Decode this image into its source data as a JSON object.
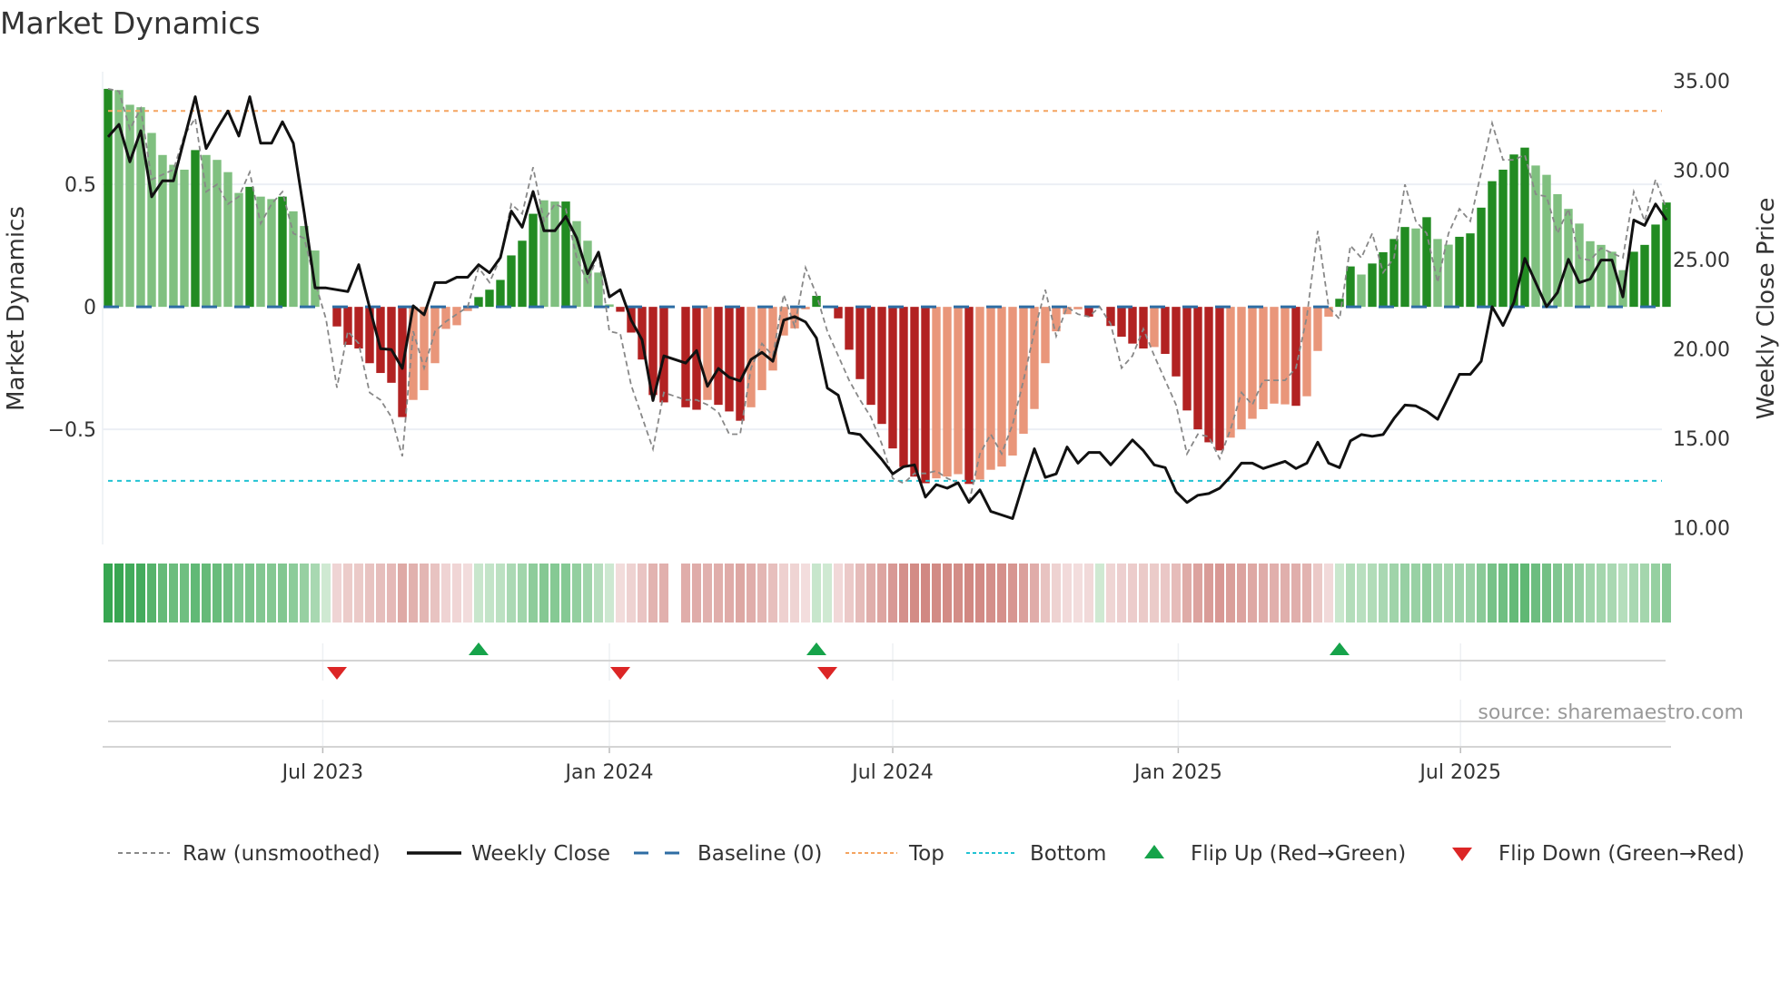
{
  "title": "Market Dynamics",
  "source": "source: sharemaestro.com",
  "chart_data": {
    "type": "bar",
    "title": "Market Dynamics",
    "ylabel": "Market Dynamics",
    "y2label": "Weekly Close Price",
    "ylim": [
      -0.97,
      0.96
    ],
    "y2lim": [
      9.05,
      35.5
    ],
    "yticks": [
      {
        "v": 0.5,
        "label": "0.5"
      },
      {
        "v": 0,
        "label": "0"
      },
      {
        "v": -0.5,
        "label": "−0.5"
      }
    ],
    "y2ticks": [
      {
        "v": 35,
        "label": "35.00"
      },
      {
        "v": 30,
        "label": "30.00"
      },
      {
        "v": 25,
        "label": "25.00"
      },
      {
        "v": 20,
        "label": "20.00"
      },
      {
        "v": 15,
        "label": "15.00"
      },
      {
        "v": 10,
        "label": "10.00"
      }
    ],
    "xticks": [
      {
        "week": 20.7,
        "label": "Jul 2023"
      },
      {
        "week": 47,
        "label": "Jan 2024"
      },
      {
        "week": 73,
        "label": "Jul 2024"
      },
      {
        "week": 99.2,
        "label": "Jan 2025"
      },
      {
        "week": 125.1,
        "label": "Jul 2025"
      }
    ],
    "weeks": 144,
    "top": 0.8,
    "bottom": -0.71,
    "baseline": 0,
    "momentum": [
      0.89,
      0.885,
      0.825,
      0.815,
      0.71,
      0.62,
      0.58,
      0.56,
      0.64,
      0.62,
      0.6,
      0.55,
      0.465,
      0.49,
      0.45,
      0.44,
      0.45,
      0.39,
      0.33,
      0.23,
      0.0,
      -0.08,
      -0.155,
      -0.17,
      -0.23,
      -0.27,
      -0.31,
      -0.45,
      -0.38,
      -0.34,
      -0.23,
      -0.09,
      -0.075,
      -0.017,
      0.04,
      0.07,
      0.11,
      0.21,
      0.27,
      0.38,
      0.435,
      0.43,
      0.43,
      0.35,
      0.27,
      0.14,
      0.01,
      -0.02,
      -0.105,
      -0.215,
      -0.36,
      -0.39,
      null,
      -0.41,
      -0.42,
      -0.38,
      -0.4,
      -0.427,
      -0.465,
      -0.41,
      -0.34,
      -0.26,
      -0.117,
      -0.088,
      -0.01,
      0.045,
      0,
      -0.047,
      -0.175,
      -0.295,
      -0.4,
      -0.478,
      -0.578,
      -0.654,
      -0.693,
      -0.72,
      -0.7,
      -0.693,
      -0.683,
      -0.723,
      -0.705,
      -0.665,
      -0.652,
      -0.607,
      -0.518,
      -0.417,
      -0.23,
      -0.1,
      -0.03,
      -0.01,
      -0.04,
      0,
      -0.078,
      -0.122,
      -0.15,
      -0.17,
      -0.164,
      -0.192,
      -0.284,
      -0.423,
      -0.5,
      -0.553,
      -0.586,
      -0.534,
      -0.5,
      -0.457,
      -0.418,
      -0.395,
      -0.398,
      -0.404,
      -0.365,
      -0.18,
      -0.04,
      0.033,
      0.165,
      0.132,
      0.177,
      0.223,
      0.277,
      0.326,
      0.32,
      0.366,
      0.277,
      0.254,
      0.286,
      0.3,
      0.405,
      0.513,
      0.56,
      0.622,
      0.65,
      0.577,
      0.539,
      0.46,
      0.4,
      0.34,
      0.268,
      0.253,
      0.225,
      0.15,
      0.225,
      0.253,
      0.336,
      0.426
    ],
    "shade": "DLLLLLLLDLLLLDLLDLLLLDDDDDDDLLLLLLDDDDDDLLDLLLLDDDDD-DDLDDDLLLLLLDLDDDDDDDDDLLLDLLLLLLLLLLDLDDDDLDDDDDDLLLLLLDLLLDDLDDDDLDLLDDDDDDDLLLLLLLLLDDDD",
    "raw": [
      0.89,
      0.88,
      0.725,
      0.81,
      0.52,
      0.54,
      0.56,
      0.7,
      0.77,
      0.47,
      0.5,
      0.42,
      0.45,
      0.55,
      0.34,
      0.42,
      0.47,
      0.3,
      0.28,
      0.1,
      -0.05,
      -0.33,
      -0.1,
      -0.15,
      -0.35,
      -0.38,
      -0.45,
      -0.61,
      -0.1,
      -0.25,
      -0.1,
      -0.06,
      -0.03,
      0.0,
      0.16,
      0.1,
      0.2,
      0.42,
      0.38,
      0.57,
      0.35,
      0.42,
      0.4,
      0.2,
      0.1,
      0.22,
      -0.1,
      -0.11,
      -0.32,
      -0.45,
      -0.58,
      -0.35,
      null,
      -0.38,
      -0.38,
      -0.4,
      -0.43,
      -0.52,
      -0.52,
      -0.25,
      -0.15,
      -0.2,
      0.05,
      -0.08,
      0.16,
      0.05,
      -0.1,
      -0.2,
      -0.3,
      -0.38,
      -0.45,
      -0.56,
      -0.7,
      -0.72,
      -0.68,
      -0.68,
      -0.67,
      -0.7,
      -0.72,
      -0.8,
      -0.6,
      -0.52,
      -0.6,
      -0.48,
      -0.3,
      -0.1,
      0.07,
      -0.12,
      0.0,
      -0.03,
      -0.04,
      0.0,
      -0.07,
      -0.25,
      -0.2,
      -0.09,
      -0.2,
      -0.3,
      -0.4,
      -0.6,
      -0.52,
      -0.53,
      -0.62,
      -0.5,
      -0.35,
      -0.4,
      -0.3,
      -0.3,
      -0.3,
      -0.25,
      -0.04,
      0.31,
      0.0,
      -0.05,
      0.25,
      0.2,
      0.3,
      0.14,
      0.2,
      0.5,
      0.35,
      0.3,
      0.1,
      0.3,
      0.4,
      0.35,
      0.55,
      0.75,
      0.6,
      0.6,
      0.62,
      0.46,
      0.45,
      0.3,
      0.4,
      0.2,
      0.19,
      0.24,
      0.22,
      0.2,
      0.47,
      0.35,
      0.52,
      0.4
    ],
    "close": [
      31.85,
      32.55,
      30.46,
      32.2,
      28.5,
      29.4,
      29.4,
      31.76,
      34.1,
      31.2,
      32.3,
      33.3,
      31.9,
      34.1,
      31.5,
      31.5,
      32.7,
      31.5,
      27.6,
      23.4,
      23.4,
      23.3,
      23.2,
      24.7,
      22.3,
      20.0,
      19.95,
      18.9,
      22.4,
      21.9,
      23.7,
      23.7,
      24.0,
      24.0,
      24.7,
      24.25,
      25.1,
      27.7,
      26.8,
      28.8,
      26.6,
      26.6,
      27.4,
      26.2,
      24.2,
      25.4,
      22.9,
      23.3,
      21.6,
      20.5,
      17.1,
      19.6,
      null,
      19.2,
      19.9,
      17.9,
      18.9,
      18.4,
      18.2,
      19.4,
      19.8,
      19.3,
      21.6,
      21.8,
      21.5,
      20.6,
      17.8,
      17.4,
      15.3,
      15.2,
      14.5,
      13.8,
      13.0,
      13.4,
      13.5,
      11.7,
      12.4,
      12.2,
      12.5,
      11.4,
      12.1,
      10.9,
      10.7,
      10.5,
      12.5,
      14.4,
      12.8,
      13.0,
      14.5,
      13.6,
      14.2,
      14.2,
      13.5,
      14.2,
      14.9,
      14.3,
      13.5,
      13.35,
      12.0,
      11.4,
      11.8,
      11.9,
      12.2,
      12.85,
      13.6,
      13.6,
      13.3,
      13.5,
      13.7,
      13.3,
      13.6,
      14.77,
      13.6,
      13.35,
      14.85,
      15.2,
      15.1,
      15.2,
      16.1,
      16.85,
      16.8,
      16.5,
      16.05,
      17.3,
      18.57,
      18.57,
      19.3,
      22.35,
      21.3,
      22.6,
      25.05,
      23.7,
      22.35,
      23.15,
      25.0,
      23.7,
      23.9,
      24.96,
      24.96,
      22.9,
      27.2,
      26.9,
      28.1,
      27.2
    ],
    "flips_up": [
      35,
      66,
      114
    ],
    "flips_down": [
      22,
      48,
      67
    ],
    "legend": {
      "placement": "bottom",
      "items": [
        {
          "key": "raw",
          "label": "Raw (unsmoothed)"
        },
        {
          "key": "close",
          "label": "Weekly Close"
        },
        {
          "key": "baseline",
          "label": "Baseline (0)"
        },
        {
          "key": "top",
          "label": "Top"
        },
        {
          "key": "bottom",
          "label": "Bottom"
        },
        {
          "key": "flip_up",
          "label": "Flip Up (Red→Green)"
        },
        {
          "key": "flip_down",
          "label": "Flip Down (Green→Red)"
        }
      ]
    },
    "colors": {
      "pos_strong": "#228b22",
      "pos_weak": "#80c080",
      "neg_strong": "#b22222",
      "neg_weak": "#e9967a",
      "raw": "#888888",
      "close": "#111111",
      "baseline": "#2e6da4",
      "top": "#f4a460",
      "bottom": "#22c3d3",
      "flip_up": "#16a34a",
      "flip_down": "#dc2626"
    }
  }
}
